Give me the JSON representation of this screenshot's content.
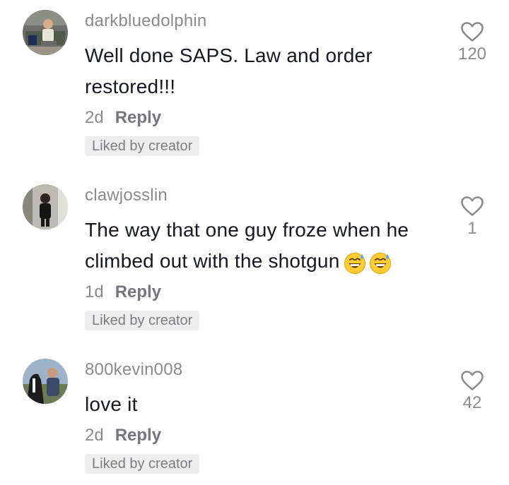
{
  "comments": [
    {
      "username": "darkbluedolphin",
      "text": "Well done SAPS. Law and order restored!!!",
      "time": "2d",
      "reply_label": "Reply",
      "badge": "Liked by creator",
      "likes": "120",
      "avatar": "photo-person-sitting"
    },
    {
      "username": "clawjosslin",
      "text": "The way that one guy froze when he climbed out with the shotgun",
      "emoji": [
        "grinning-face-with-sweat-emoji",
        "grinning-face-with-sweat-emoji"
      ],
      "time": "1d",
      "reply_label": "Reply",
      "badge": "Liked by creator",
      "likes": "1",
      "avatar": "photo-person-mirror"
    },
    {
      "username": "800kevin008",
      "text": "love it",
      "time": "2d",
      "reply_label": "Reply",
      "badge": "Liked by creator",
      "likes": "42",
      "avatar": "photo-person-with-horse"
    }
  ],
  "colors": {
    "username": "#8a8b91",
    "text": "#161823",
    "badge_bg": "#eeeeef",
    "icon": "#8a8b91"
  }
}
